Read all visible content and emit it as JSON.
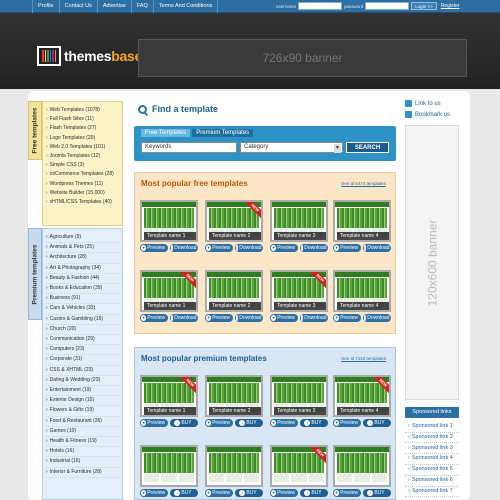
{
  "topnav": [
    "Profile",
    "Contact Us",
    "Advertise",
    "FAQ",
    "Terms And Conditions"
  ],
  "login": {
    "username_label": "username",
    "password_label": "password",
    "button": "Login >>",
    "register": "Register"
  },
  "logo": {
    "first": "themes",
    "second": "base"
  },
  "banner_top": "726x90 banner",
  "sidebar": {
    "free_tab": "Free templates",
    "premium_tab": "Premium templates",
    "free_items": [
      "Web Templates (1078)",
      "Full Flash Sites (11)",
      "Flash Templates (27)",
      "Logo Templates (29)",
      "Web 2.0 Templates (101)",
      "Joomla Templates (12)",
      "Simple CSS (3)",
      "osCommerce Templates (28)",
      "Wordpress Themes (11)",
      "Website Builder (15,000)",
      "xHTML/CSS Templates (40)"
    ],
    "premium_items": [
      "Agriculture (9)",
      "Animals & Pets (25)",
      "Architecture (28)",
      "Art & Photography (34)",
      "Beauty & Fashion (44)",
      "Books & Education (39)",
      "Business (91)",
      "Cars & Vehicles (33)",
      "Casino & Gambling (15)",
      "Church (20)",
      "Communication (29)",
      "Computers (23)",
      "Corporate (31)",
      "CSS & XHTML (23)",
      "Dating & Wedding (23)",
      "Entertainment (19)",
      "Exterior Design (10)",
      "Flowers & Gifts (19)",
      "Food & Restaurant (26)",
      "Games (10)",
      "Health & Fitness (19)",
      "Hotels (16)",
      "Industrial (16)",
      "Interior & Furniture (28)"
    ]
  },
  "find": {
    "title": "Find a template",
    "tab_free": "Free Templates",
    "tab_premium": "Premium Templates",
    "keywords": "Keywords",
    "category": "Category",
    "search_button": "SEARCH"
  },
  "free_section": {
    "title": "Most popular free templates",
    "see_all": "See al 5474 templates",
    "templates": [
      {
        "name": "Template name 1",
        "ribbon": ""
      },
      {
        "name": "Template name 2",
        "ribbon": "NEW"
      },
      {
        "name": "Template name 3",
        "ribbon": ""
      },
      {
        "name": "Template name 4",
        "ribbon": ""
      },
      {
        "name": "Template name 1",
        "ribbon": "NEW"
      },
      {
        "name": "Template name 2",
        "ribbon": ""
      },
      {
        "name": "Template name 3",
        "ribbon": "NEW"
      },
      {
        "name": "Template name 4",
        "ribbon": ""
      }
    ],
    "preview": "Preview",
    "download": "Download"
  },
  "premium_section": {
    "title": "Most popular premium templates",
    "see_all": "See al 7142 templates",
    "templates": [
      {
        "name": "Template name 1",
        "ribbon": "NEW"
      },
      {
        "name": "Template name 2",
        "ribbon": ""
      },
      {
        "name": "Template name 3",
        "ribbon": ""
      },
      {
        "name": "Template name 4",
        "ribbon": "NEW"
      },
      {
        "name": "",
        "ribbon": ""
      },
      {
        "name": "",
        "ribbon": ""
      },
      {
        "name": "",
        "ribbon": "NEW"
      },
      {
        "name": "",
        "ribbon": ""
      }
    ],
    "preview": "Preview",
    "buy": "BUY"
  },
  "right": {
    "link_to_us": "Link to us",
    "bookmark_us": "Bookmark us",
    "banner_side": "120x600 banner",
    "sponsored_title": "Sponsored links",
    "sponsored": [
      "Sponsored link 1",
      "Sponsored link 2",
      "Sponsored link 3",
      "Sponsored link 4",
      "Sponsored link 5",
      "Sponsored link 6",
      "Sponsored link 7"
    ]
  },
  "colors": {
    "top_bar": "#2d6fa3",
    "header_bg": "#2b2b2b",
    "accent_orange": "#f7a521",
    "free_section_bg": "#fbe6c8",
    "premium_section_bg": "#d9e6f4",
    "new_ribbon": "#d1231d"
  }
}
